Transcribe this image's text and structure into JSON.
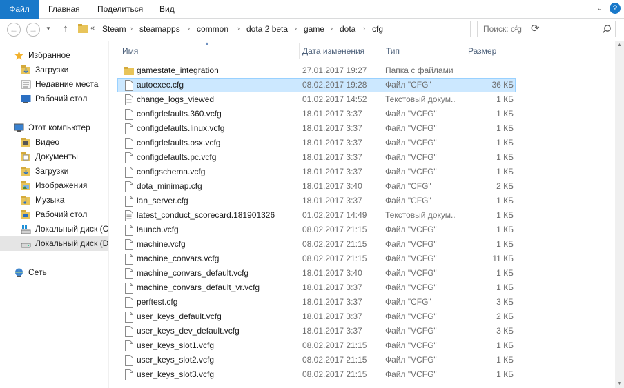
{
  "ribbon": {
    "tabs": [
      {
        "label": "Файл"
      },
      {
        "label": "Главная"
      },
      {
        "label": "Поделиться"
      },
      {
        "label": "Вид"
      }
    ],
    "toggle_glyph": "⌄",
    "help_glyph": "?"
  },
  "nav": {
    "back_glyph": "←",
    "forward_glyph": "→",
    "recent_glyph": "▼",
    "up_glyph": "↑",
    "overflow_glyph": "«",
    "breadcrumb": [
      "Steam",
      "steamapps",
      "common",
      "dota 2 beta",
      "game",
      "dota",
      "cfg"
    ],
    "sep_glyph": "›",
    "dropdown_glyph": "⌄",
    "refresh_glyph": "⟳",
    "search_placeholder": "Поиск: cfg"
  },
  "sidebar": {
    "items": [
      {
        "label": "Избранное",
        "icon": "star-icon"
      },
      {
        "label": "Загрузки",
        "icon": "downloads-folder-icon"
      },
      {
        "label": "Недавние места",
        "icon": "recent-places-icon"
      },
      {
        "label": "Рабочий стол",
        "icon": "desktop-icon"
      },
      {
        "label": "Этот компьютер",
        "icon": "computer-icon"
      },
      {
        "label": "Видео",
        "icon": "video-folder-icon"
      },
      {
        "label": "Документы",
        "icon": "documents-folder-icon"
      },
      {
        "label": "Загрузки",
        "icon": "downloads-folder-icon"
      },
      {
        "label": "Изображения",
        "icon": "pictures-folder-icon"
      },
      {
        "label": "Музыка",
        "icon": "music-folder-icon"
      },
      {
        "label": "Рабочий стол",
        "icon": "desktop-folder-icon"
      },
      {
        "label": "Локальный диск (C",
        "icon": "system-drive-icon"
      },
      {
        "label": "Локальный диск (D",
        "icon": "drive-icon"
      },
      {
        "label": "Сеть",
        "icon": "network-icon"
      }
    ]
  },
  "columns": {
    "name": "Имя",
    "date": "Дата изменения",
    "type": "Тип",
    "size": "Размер",
    "sort_glyph": "▲"
  },
  "files": [
    {
      "name": "gamestate_integration",
      "date": "27.01.2017 19:27",
      "type": "Папка с файлами",
      "size": "",
      "kind": "folder"
    },
    {
      "name": "autoexec.cfg",
      "date": "08.02.2017 19:28",
      "type": "Файл \"CFG\"",
      "size": "36 КБ",
      "kind": "file"
    },
    {
      "name": "change_logs_viewed",
      "date": "01.02.2017 14:52",
      "type": "Текстовый докум...",
      "size": "1 КБ",
      "kind": "text"
    },
    {
      "name": "configdefaults.360.vcfg",
      "date": "18.01.2017 3:37",
      "type": "Файл \"VCFG\"",
      "size": "1 КБ",
      "kind": "file"
    },
    {
      "name": "configdefaults.linux.vcfg",
      "date": "18.01.2017 3:37",
      "type": "Файл \"VCFG\"",
      "size": "1 КБ",
      "kind": "file"
    },
    {
      "name": "configdefaults.osx.vcfg",
      "date": "18.01.2017 3:37",
      "type": "Файл \"VCFG\"",
      "size": "1 КБ",
      "kind": "file"
    },
    {
      "name": "configdefaults.pc.vcfg",
      "date": "18.01.2017 3:37",
      "type": "Файл \"VCFG\"",
      "size": "1 КБ",
      "kind": "file"
    },
    {
      "name": "configschema.vcfg",
      "date": "18.01.2017 3:37",
      "type": "Файл \"VCFG\"",
      "size": "1 КБ",
      "kind": "file"
    },
    {
      "name": "dota_minimap.cfg",
      "date": "18.01.2017 3:40",
      "type": "Файл \"CFG\"",
      "size": "2 КБ",
      "kind": "file"
    },
    {
      "name": "lan_server.cfg",
      "date": "18.01.2017 3:37",
      "type": "Файл \"CFG\"",
      "size": "1 КБ",
      "kind": "file"
    },
    {
      "name": "latest_conduct_scorecard.181901326",
      "date": "01.02.2017 14:49",
      "type": "Текстовый докум...",
      "size": "1 КБ",
      "kind": "text"
    },
    {
      "name": "launch.vcfg",
      "date": "08.02.2017 21:15",
      "type": "Файл \"VCFG\"",
      "size": "1 КБ",
      "kind": "file"
    },
    {
      "name": "machine.vcfg",
      "date": "08.02.2017 21:15",
      "type": "Файл \"VCFG\"",
      "size": "1 КБ",
      "kind": "file"
    },
    {
      "name": "machine_convars.vcfg",
      "date": "08.02.2017 21:15",
      "type": "Файл \"VCFG\"",
      "size": "11 КБ",
      "kind": "file"
    },
    {
      "name": "machine_convars_default.vcfg",
      "date": "18.01.2017 3:40",
      "type": "Файл \"VCFG\"",
      "size": "1 КБ",
      "kind": "file"
    },
    {
      "name": "machine_convars_default_vr.vcfg",
      "date": "18.01.2017 3:37",
      "type": "Файл \"VCFG\"",
      "size": "1 КБ",
      "kind": "file"
    },
    {
      "name": "perftest.cfg",
      "date": "18.01.2017 3:37",
      "type": "Файл \"CFG\"",
      "size": "3 КБ",
      "kind": "file"
    },
    {
      "name": "user_keys_default.vcfg",
      "date": "18.01.2017 3:37",
      "type": "Файл \"VCFG\"",
      "size": "2 КБ",
      "kind": "file"
    },
    {
      "name": "user_keys_dev_default.vcfg",
      "date": "18.01.2017 3:37",
      "type": "Файл \"VCFG\"",
      "size": "3 КБ",
      "kind": "file"
    },
    {
      "name": "user_keys_slot1.vcfg",
      "date": "08.02.2017 21:15",
      "type": "Файл \"VCFG\"",
      "size": "1 КБ",
      "kind": "file"
    },
    {
      "name": "user_keys_slot2.vcfg",
      "date": "08.02.2017 21:15",
      "type": "Файл \"VCFG\"",
      "size": "1 КБ",
      "kind": "file"
    },
    {
      "name": "user_keys_slot3.vcfg",
      "date": "08.02.2017 21:15",
      "type": "Файл \"VCFG\"",
      "size": "1 КБ",
      "kind": "file"
    }
  ],
  "selected_file": "autoexec.cfg",
  "selected_drive": "Локальный диск (D",
  "colors": {
    "accent": "#1979ca",
    "selection": "#cce8ff",
    "selection_border": "#99d1ff",
    "folder": "#e8c45a"
  },
  "scrollbar": {
    "up_glyph": "▲",
    "down_glyph": "▼"
  }
}
